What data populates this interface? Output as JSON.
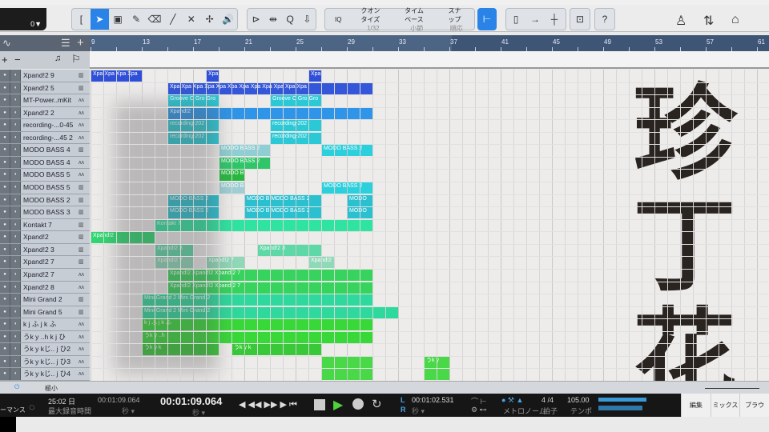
{
  "toolbar": {
    "counter_value": "0▼",
    "quantize_label": "クオンタイズ",
    "quantize_value": "1/32",
    "timebase_label": "タイムベース",
    "timebase_value": "小節",
    "snap_label": "スナップ",
    "snap_value": "順応",
    "help": "?",
    "iq": "IQ"
  },
  "ruler": {
    "bars": [
      "9",
      "13",
      "17",
      "21",
      "25",
      "29",
      "33",
      "37",
      "41",
      "45",
      "49",
      "53",
      "57",
      "61"
    ]
  },
  "tracks": [
    {
      "name": "Xpand!2 9",
      "type": "instrument"
    },
    {
      "name": "Xpand!2 5",
      "type": "instrument"
    },
    {
      "name": "MT-Power..mKit",
      "type": "audio"
    },
    {
      "name": "Xpand!2 2",
      "type": "audio"
    },
    {
      "name": "recording-...0-45",
      "type": "audio"
    },
    {
      "name": "recording-...45 2",
      "type": "audio"
    },
    {
      "name": "MODO BASS 4",
      "type": "instrument"
    },
    {
      "name": "MODO BASS 4",
      "type": "audio"
    },
    {
      "name": "MODO BASS 5",
      "type": "audio"
    },
    {
      "name": "MODO BASS 5",
      "type": "instrument"
    },
    {
      "name": "MODO BASS 2",
      "type": "instrument"
    },
    {
      "name": "MODO BASS 3",
      "type": "instrument"
    },
    {
      "name": "Kontakt 7",
      "type": "instrument"
    },
    {
      "name": "Xpand!2",
      "type": "instrument"
    },
    {
      "name": "Xpand!2 3",
      "type": "instrument"
    },
    {
      "name": "Xpand!2 7",
      "type": "instrument"
    },
    {
      "name": "Xpand!2 7",
      "type": "audio"
    },
    {
      "name": "Xpand!2 8",
      "type": "audio"
    },
    {
      "name": "Mini Grand 2",
      "type": "instrument"
    },
    {
      "name": "Mini Grand 5",
      "type": "instrument"
    },
    {
      "name": "k j ふ j k ふ",
      "type": "audio"
    },
    {
      "name": "うk y ..h k j ひ",
      "type": "audio"
    },
    {
      "name": "うk y kじ.. j ひ2",
      "type": "audio"
    },
    {
      "name": "うk y kじ.. j ひ3",
      "type": "audio"
    },
    {
      "name": "うk y kじ.. j ひ4",
      "type": "audio"
    }
  ],
  "clips": [
    {
      "t": 0,
      "s": 9,
      "e": 13,
      "l": "Xpa Xpa Xpa Xpa",
      "c": "#2f4fd8"
    },
    {
      "t": 0,
      "s": 18,
      "e": 19,
      "l": "Xpa",
      "c": "#2f4fd8"
    },
    {
      "t": 0,
      "s": 26,
      "e": 27,
      "l": "Xpa",
      "c": "#2f4fd8"
    },
    {
      "t": 1,
      "s": 15,
      "e": 31,
      "l": "Xpa Xpa Xpa Xpa Xpa Xpa Xpa Xpa Xpa Xpa Xpa Xpa",
      "c": "#3456d8"
    },
    {
      "t": 2,
      "s": 15,
      "e": 19,
      "l": "Groove C Gro Gro",
      "c": "#2bc9d6"
    },
    {
      "t": 2,
      "s": 23,
      "e": 27,
      "l": "Groove C Gro Gro",
      "c": "#2bc9d6"
    },
    {
      "t": 3,
      "s": 15,
      "e": 31,
      "l": "Xpand!2",
      "c": "#2e95e8"
    },
    {
      "t": 4,
      "s": 15,
      "e": 19,
      "l": "recording-202",
      "c": "#2bc9d6"
    },
    {
      "t": 4,
      "s": 23,
      "e": 27,
      "l": "recording-202",
      "c": "#2bc9d6"
    },
    {
      "t": 5,
      "s": 15,
      "e": 19,
      "l": "recording-202",
      "c": "#2bc9d6"
    },
    {
      "t": 5,
      "s": 23,
      "e": 27,
      "l": "recording-202",
      "c": "#2bc9d6"
    },
    {
      "t": 6,
      "s": 19,
      "e": 23,
      "l": "MODO BASS 2",
      "c": "#8fcfd4"
    },
    {
      "t": 6,
      "s": 27,
      "e": 31,
      "l": "MODO BASS 2",
      "c": "#2bd0dc"
    },
    {
      "t": 7,
      "s": 19,
      "e": 23,
      "l": "MODO BASS 2",
      "c": "#2fc66a"
    },
    {
      "t": 8,
      "s": 19,
      "e": 21,
      "l": "MODO B",
      "c": "#28b840"
    },
    {
      "t": 9,
      "s": 19,
      "e": 21,
      "l": "MODO B",
      "c": "#9fcfd4"
    },
    {
      "t": 9,
      "s": 27,
      "e": 31,
      "l": "MODO BASS 2",
      "c": "#2bd0dc"
    },
    {
      "t": 10,
      "s": 15,
      "e": 19,
      "l": "MODO BASS 2",
      "c": "#2bc0d0"
    },
    {
      "t": 10,
      "s": 21,
      "e": 27,
      "l": "MODO B MODO BASS 2",
      "c": "#2bc0d0"
    },
    {
      "t": 10,
      "s": 29,
      "e": 31,
      "l": "MODO",
      "c": "#2bc0d0"
    },
    {
      "t": 11,
      "s": 15,
      "e": 19,
      "l": "MODO BASS 2",
      "c": "#2bc0d0"
    },
    {
      "t": 11,
      "s": 21,
      "e": 27,
      "l": "MODO B MODO BASS 2",
      "c": "#2bc0d0"
    },
    {
      "t": 11,
      "s": 29,
      "e": 31,
      "l": "MODO",
      "c": "#2bc0d0"
    },
    {
      "t": 12,
      "s": 14,
      "e": 31,
      "l": "Kontakt 7",
      "c": "#2fe3a0"
    },
    {
      "t": 13,
      "s": 9,
      "e": 14,
      "l": "Xpand!2",
      "c": "#2fd870"
    },
    {
      "t": 14,
      "s": 14,
      "e": 17,
      "l": "Xpand!2 3",
      "c": "#5fd8a8"
    },
    {
      "t": 14,
      "s": 22,
      "e": 27,
      "l": "Xpand!2 3",
      "c": "#5fd8a8"
    },
    {
      "t": 15,
      "s": 14,
      "e": 17,
      "l": "Xpand!2 7",
      "c": "#8fd8b8"
    },
    {
      "t": 15,
      "s": 18,
      "e": 21,
      "l": "Xpand!2 7",
      "c": "#8fd8b8"
    },
    {
      "t": 15,
      "s": 26,
      "e": 28,
      "l": "Xpand!2 7",
      "c": "#8fd8b8"
    },
    {
      "t": 16,
      "s": 15,
      "e": 31,
      "l": "Xpand!2 Xpand!2 Xpand!2 7",
      "c": "#36d45c"
    },
    {
      "t": 17,
      "s": 15,
      "e": 31,
      "l": "Xpand!2 Xpand!2 Xpand!2 7",
      "c": "#36d45c"
    },
    {
      "t": 18,
      "s": 13,
      "e": 31,
      "l": "Mini Grand 2 Mini Grand 2",
      "c": "#2fd89c"
    },
    {
      "t": 19,
      "s": 13,
      "e": 33,
      "l": "Mini Grand 2 Mini Grand 2",
      "c": "#2fd89c"
    },
    {
      "t": 20,
      "s": 13,
      "e": 31,
      "l": "k j ふ j k ふ",
      "c": "#38d838"
    },
    {
      "t": 21,
      "s": 13,
      "e": 31,
      "l": "うk y ..h",
      "c": "#38d838"
    },
    {
      "t": 22,
      "s": 13,
      "e": 19,
      "l": "うk y k",
      "c": "#38c838"
    },
    {
      "t": 22,
      "s": 20,
      "e": 27,
      "l": "うk y k",
      "c": "#38c838"
    },
    {
      "t": 23,
      "s": 27,
      "e": 31,
      "l": "",
      "c": "#48d848"
    },
    {
      "t": 23,
      "s": 35,
      "e": 37,
      "l": "うk y",
      "c": "#48d848"
    },
    {
      "t": 24,
      "s": 27,
      "e": 31,
      "l": "",
      "c": "#48d848"
    },
    {
      "t": 24,
      "s": 35,
      "e": 37,
      "l": "",
      "c": "#48d848"
    }
  ],
  "overlay": {
    "text": "珍丁花"
  },
  "bottom": {
    "zoom_label": "極小"
  },
  "transport": {
    "perf": "ーマンス",
    "record_time": "25:02 日",
    "record_time_label": "最大録音時間",
    "secondary_time": "00:01:09.064",
    "secondary_unit": "秒 ▾",
    "main_time": "00:01:09.064",
    "main_unit": "秒 ▾",
    "loop_l": "L",
    "loop_r": "R",
    "loop_time": "00:01:02.531",
    "loop_unit": "秒 ▾",
    "metronome_label": "メトロノーム",
    "signature": "4 /4",
    "signature_label": "拍子",
    "tempo": "105.00",
    "tempo_label": "テンポ"
  },
  "pages": [
    "編集",
    "ミックス",
    "ブラウ"
  ]
}
